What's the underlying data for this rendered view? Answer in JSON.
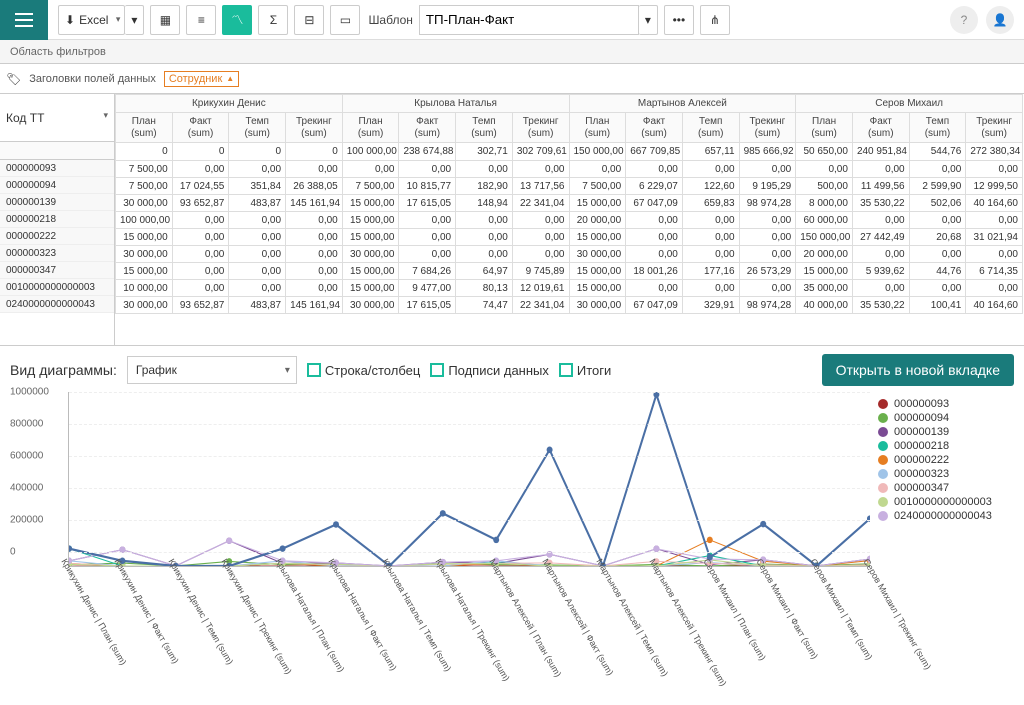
{
  "toolbar": {
    "excel_label": "Excel",
    "template_label": "Шаблон",
    "template_value": "ТП-План-Факт"
  },
  "filter_area": {
    "label": "Область фильтров"
  },
  "headers": {
    "label": "Заголовки полей данных",
    "tag": "Сотрудник"
  },
  "row_header": {
    "tt_label": "Код ТТ"
  },
  "employees": [
    "Крикухин Денис",
    "Крылова Наталья",
    "Мартынов Алексей",
    "Серов Михаил"
  ],
  "cols": [
    "План (sum)",
    "Факт (sum)",
    "Темп (sum)",
    "Трекинг (sum)"
  ],
  "row_codes": [
    "000000093",
    "000000094",
    "000000139",
    "000000218",
    "000000222",
    "000000323",
    "000000347",
    "0010000000000003",
    "0240000000000043"
  ],
  "totals": [
    [
      "0",
      "0",
      "0",
      "0",
      "100 000,00",
      "238 674,88",
      "302,71",
      "302 709,61",
      "150 000,00",
      "667 709,85",
      "657,11",
      "985 666,92",
      "50 650,00",
      "240 951,84",
      "544,76",
      "272 380,34"
    ]
  ],
  "rows": [
    [
      "7 500,00",
      "0,00",
      "0,00",
      "0,00",
      "0,00",
      "0,00",
      "0,00",
      "0,00",
      "0,00",
      "0,00",
      "0,00",
      "0,00",
      "0,00",
      "0,00",
      "0,00",
      "0,00"
    ],
    [
      "7 500,00",
      "17 024,55",
      "351,84",
      "26 388,05",
      "7 500,00",
      "10 815,77",
      "182,90",
      "13 717,56",
      "7 500,00",
      "6 229,07",
      "122,60",
      "9 195,29",
      "500,00",
      "11 499,56",
      "2 599,90",
      "12 999,50"
    ],
    [
      "30 000,00",
      "93 652,87",
      "483,87",
      "145 161,94",
      "15 000,00",
      "17 615,05",
      "148,94",
      "22 341,04",
      "15 000,00",
      "67 047,09",
      "659,83",
      "98 974,28",
      "8 000,00",
      "35 530,22",
      "502,06",
      "40 164,60"
    ],
    [
      "100 000,00",
      "0,00",
      "0,00",
      "0,00",
      "15 000,00",
      "0,00",
      "0,00",
      "0,00",
      "20 000,00",
      "0,00",
      "0,00",
      "0,00",
      "60 000,00",
      "0,00",
      "0,00",
      "0,00"
    ],
    [
      "15 000,00",
      "0,00",
      "0,00",
      "0,00",
      "15 000,00",
      "0,00",
      "0,00",
      "0,00",
      "15 000,00",
      "0,00",
      "0,00",
      "0,00",
      "150 000,00",
      "27 442,49",
      "20,68",
      "31 021,94"
    ],
    [
      "30 000,00",
      "0,00",
      "0,00",
      "0,00",
      "30 000,00",
      "0,00",
      "0,00",
      "0,00",
      "30 000,00",
      "0,00",
      "0,00",
      "0,00",
      "20 000,00",
      "0,00",
      "0,00",
      "0,00"
    ],
    [
      "15 000,00",
      "0,00",
      "0,00",
      "0,00",
      "15 000,00",
      "7 684,26",
      "64,97",
      "9 745,89",
      "15 000,00",
      "18 001,26",
      "177,16",
      "26 573,29",
      "15 000,00",
      "5 939,62",
      "44,76",
      "6 714,35"
    ],
    [
      "10 000,00",
      "0,00",
      "0,00",
      "0,00",
      "15 000,00",
      "9 477,00",
      "80,13",
      "12 019,61",
      "15 000,00",
      "0,00",
      "0,00",
      "0,00",
      "35 000,00",
      "0,00",
      "0,00",
      "0,00"
    ],
    [
      "30 000,00",
      "93 652,87",
      "483,87",
      "145 161,94",
      "30 000,00",
      "17 615,05",
      "74,47",
      "22 341,04",
      "30 000,00",
      "67 047,09",
      "329,91",
      "98 974,28",
      "40 000,00",
      "35 530,22",
      "100,41",
      "40 164,60"
    ]
  ],
  "chart": {
    "view_label": "Вид диаграммы:",
    "select_value": "График",
    "checkboxes": [
      "Строка/столбец",
      "Подписи данных",
      "Итоги"
    ],
    "open_button": "Открыть в новой вкладке"
  },
  "chart_data": {
    "type": "line",
    "ylim": [
      0,
      1000000
    ],
    "yticks": [
      0,
      200000,
      400000,
      600000,
      800000,
      1000000
    ],
    "x": [
      "Крикухин Денис | План (sum)",
      "Крикухин Денис | Факт (sum)",
      "Крикухин Денис | Темп (sum)",
      "Крикухин Денис | Трекинг (sum)",
      "Крылова Наталья | План (sum)",
      "Крылова Наталья | Факт (sum)",
      "Крылова Наталья | Темп (sum)",
      "Крылова Наталья | Трекинг (sum)",
      "Мартынов Алексей | План (sum)",
      "Мартынов Алексей | Факт (sum)",
      "Мартынов Алексей | Темп (sum)",
      "Мартынов Алексей | Трекинг (sum)",
      "Серов Михаил | План (sum)",
      "Серов Михаил | Факт (sum)",
      "Серов Михаил | Темп (sum)",
      "Серов Михаил | Трекинг (sum)"
    ],
    "series": [
      {
        "name": "000000093",
        "color": "#a52a2a",
        "values": [
          7500,
          0,
          0,
          0,
          0,
          0,
          0,
          0,
          0,
          0,
          0,
          0,
          0,
          0,
          0,
          0
        ]
      },
      {
        "name": "000000094",
        "color": "#6ab04c",
        "values": [
          7500,
          17025,
          352,
          26388,
          7500,
          10816,
          183,
          13718,
          7500,
          6229,
          123,
          9195,
          500,
          11500,
          2600,
          13000
        ]
      },
      {
        "name": "000000139",
        "color": "#7b4b94",
        "values": [
          30000,
          93653,
          484,
          145162,
          15000,
          17615,
          149,
          22341,
          15000,
          67047,
          660,
          98974,
          8000,
          35530,
          502,
          40165
        ]
      },
      {
        "name": "000000218",
        "color": "#1abc9c",
        "values": [
          100000,
          0,
          0,
          0,
          15000,
          0,
          0,
          0,
          20000,
          0,
          0,
          0,
          60000,
          0,
          0,
          0
        ]
      },
      {
        "name": "000000222",
        "color": "#e67e22",
        "values": [
          15000,
          0,
          0,
          0,
          15000,
          0,
          0,
          0,
          15000,
          0,
          0,
          0,
          150000,
          27442,
          21,
          31022
        ]
      },
      {
        "name": "000000323",
        "color": "#a0c4e8",
        "values": [
          30000,
          0,
          0,
          0,
          30000,
          0,
          0,
          0,
          30000,
          0,
          0,
          0,
          20000,
          0,
          0,
          0
        ]
      },
      {
        "name": "000000347",
        "color": "#f0b9b9",
        "values": [
          15000,
          0,
          0,
          0,
          15000,
          7684,
          65,
          9746,
          15000,
          18001,
          177,
          26573,
          15000,
          5940,
          45,
          6714
        ]
      },
      {
        "name": "0010000000000003",
        "color": "#c0d890",
        "values": [
          10000,
          0,
          0,
          0,
          15000,
          9477,
          80,
          12020,
          15000,
          0,
          0,
          0,
          35000,
          0,
          0,
          0
        ]
      },
      {
        "name": "0240000000000043",
        "color": "#c8b0e0",
        "values": [
          30000,
          93653,
          484,
          145162,
          30000,
          17615,
          74,
          22341,
          30000,
          67047,
          330,
          98974,
          40000,
          35530,
          100,
          40165
        ]
      }
    ],
    "blue_series": {
      "name": "blue-marked",
      "color": "#4a6fa5",
      "values": [
        100000,
        30000,
        0,
        0,
        100000,
        238675,
        303,
        302710,
        150000,
        667710,
        657,
        985667,
        50650,
        240952,
        545,
        272380
      ]
    }
  }
}
